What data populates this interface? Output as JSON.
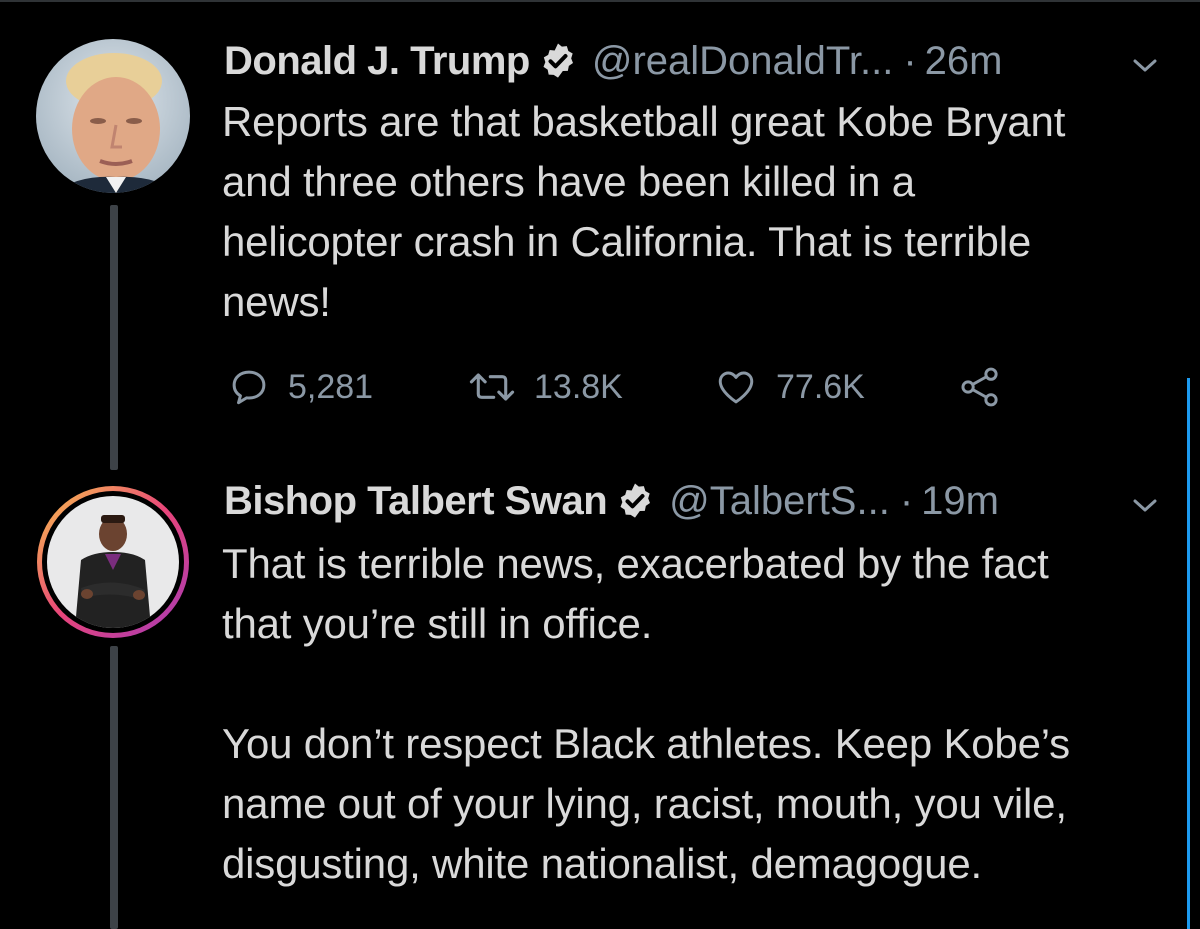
{
  "tweets": [
    {
      "name": "Donald J. Trump",
      "handle": "@realDonaldTr...",
      "separator": "·",
      "time": "26m",
      "text": "Reports are that basketball great Kobe Bryant\nand three others have been killed in a\nhelicopter crash in California. That is terrible\nnews!",
      "replies": "5,281",
      "retweets": "13.8K",
      "likes": "77.6K",
      "verified": true,
      "avatar_icon": "profile-photo-man-suit"
    },
    {
      "name": "Bishop Talbert Swan",
      "handle": "@TalbertS...",
      "separator": "·",
      "time": "19m",
      "text": "That is terrible news, exacerbated by the fact\nthat you’re still in office.\n\nYou don’t respect Black athletes. Keep Kobe’s\nname out of your lying, racist, mouth, you vile,\ndisgusting, white nationalist, demagogue.",
      "verified": true,
      "avatar_icon": "profile-photo-man-arms-crossed"
    }
  ],
  "colors": {
    "background": "#000000",
    "text": "#d9d9d9",
    "muted": "#8b98a5",
    "accent": "#1d9bf0",
    "thread_line": "#3d4247"
  }
}
